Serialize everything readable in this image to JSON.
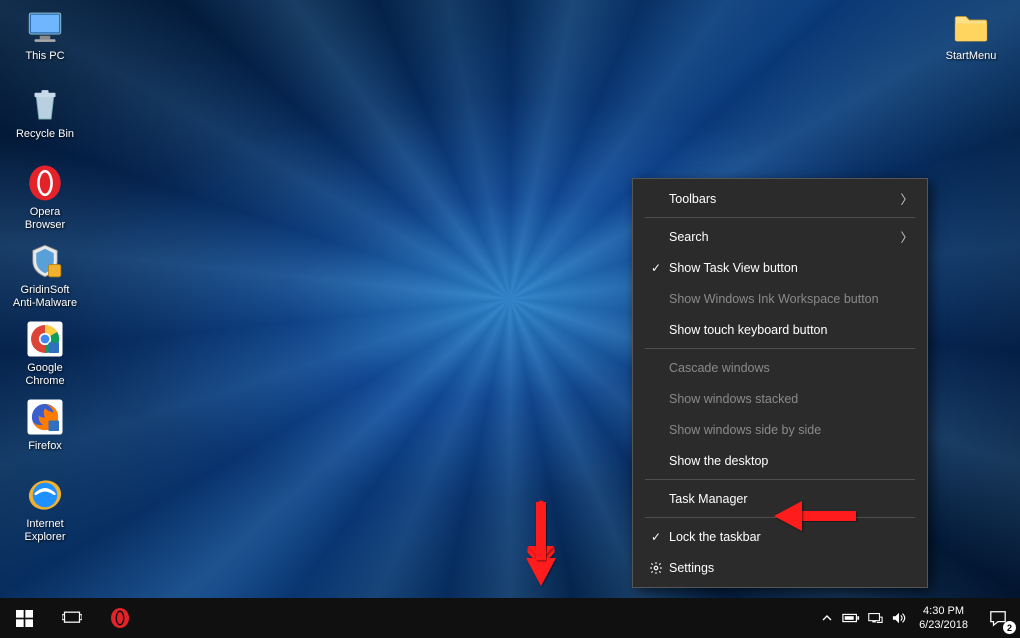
{
  "desktop": {
    "icons": [
      {
        "name": "this-pc",
        "label": "This PC",
        "type": "pc"
      },
      {
        "name": "recycle-bin",
        "label": "Recycle Bin",
        "type": "bin"
      },
      {
        "name": "opera-browser",
        "label": "Opera Browser",
        "type": "opera"
      },
      {
        "name": "gridinsoft",
        "label": "GridinSoft Anti-Malware",
        "type": "shield"
      },
      {
        "name": "google-chrome",
        "label": "Google Chrome",
        "type": "chrome"
      },
      {
        "name": "firefox",
        "label": "Firefox",
        "type": "ff"
      },
      {
        "name": "internet-explorer",
        "label": "Internet Explorer",
        "type": "ie"
      }
    ],
    "startmenu_icon": {
      "name": "startmenu-folder",
      "label": "StartMenu",
      "type": "folder"
    }
  },
  "context_menu": {
    "groups": [
      [
        {
          "id": "toolbars",
          "label": "Toolbars",
          "submenu": true
        }
      ],
      [
        {
          "id": "search",
          "label": "Search",
          "submenu": true
        },
        {
          "id": "show-task-view",
          "label": "Show Task View button",
          "checked": true
        },
        {
          "id": "show-ink",
          "label": "Show Windows Ink Workspace button",
          "disabled": true
        },
        {
          "id": "show-touch-kb",
          "label": "Show touch keyboard button"
        }
      ],
      [
        {
          "id": "cascade",
          "label": "Cascade windows",
          "disabled": true
        },
        {
          "id": "stacked",
          "label": "Show windows stacked",
          "disabled": true
        },
        {
          "id": "side-by-side",
          "label": "Show windows side by side",
          "disabled": true
        },
        {
          "id": "show-desktop",
          "label": "Show the desktop"
        }
      ],
      [
        {
          "id": "task-manager",
          "label": "Task Manager"
        }
      ],
      [
        {
          "id": "lock-taskbar",
          "label": "Lock the taskbar",
          "checked": true
        },
        {
          "id": "settings",
          "label": "Settings",
          "gear": true
        }
      ]
    ]
  },
  "taskbar": {
    "buttons": [
      {
        "name": "start-button",
        "icon": "windows"
      },
      {
        "name": "task-view-button",
        "icon": "taskview"
      },
      {
        "name": "opera-taskbar",
        "icon": "opera"
      }
    ],
    "tray": {
      "chevron": "^",
      "icons": [
        "battery",
        "network",
        "volume"
      ],
      "time": "4:30 PM",
      "date": "6/23/2018",
      "action_center_badge": "2"
    }
  }
}
